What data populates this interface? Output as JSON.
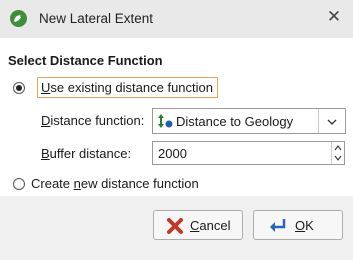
{
  "window": {
    "title": "New Lateral Extent",
    "close_glyph": "✕",
    "app_icon": "leapfrog-icon"
  },
  "section": {
    "title": "Select Distance Function"
  },
  "options": {
    "use_existing": {
      "prefix": "",
      "mnemonic": "U",
      "rest": "se existing distance function",
      "selected": true
    },
    "create_new": {
      "prefix": "Create ",
      "mnemonic": "n",
      "rest": "ew distance function",
      "selected": false
    }
  },
  "fields": {
    "distance_function": {
      "mnemonic": "D",
      "label_rest": "istance function:",
      "value": "Distance to Geology",
      "icon": "distance-function-icon"
    },
    "buffer_distance": {
      "mnemonic": "B",
      "label_rest": "uffer distance:",
      "value": "2000"
    }
  },
  "buttons": {
    "cancel": {
      "mnemonic": "C",
      "rest": "ancel",
      "icon": "cancel-x-icon"
    },
    "ok": {
      "mnemonic": "O",
      "rest": "K",
      "icon": "ok-arrow-icon"
    }
  },
  "colors": {
    "accent_focus": "#e8a25a",
    "app_green": "#3f8f3a",
    "cancel_red": "#c0392b"
  }
}
